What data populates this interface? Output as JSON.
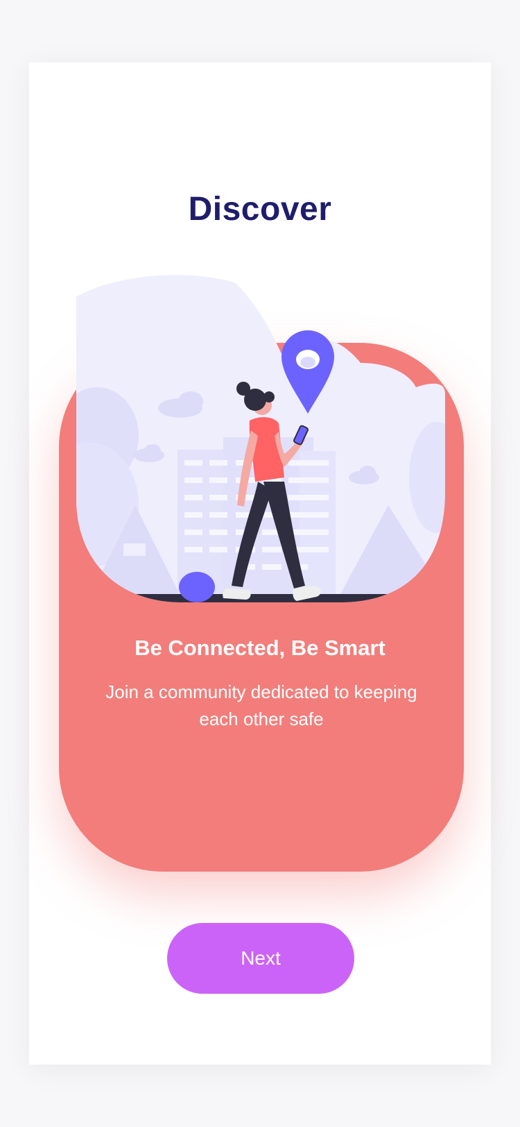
{
  "screen": {
    "title": "Discover"
  },
  "card": {
    "headline": "Be Connected, Be Smart",
    "description": "Join a community dedicated to keeping each other safe",
    "illustration_icon": "location-pin-icon"
  },
  "actions": {
    "next_label": "Next"
  },
  "colors": {
    "title": "#1f1d6b",
    "card": "#f27d7a",
    "button": "#cc63f9",
    "pin": "#6c63ff",
    "illustration_bg": "#eeeefd"
  }
}
